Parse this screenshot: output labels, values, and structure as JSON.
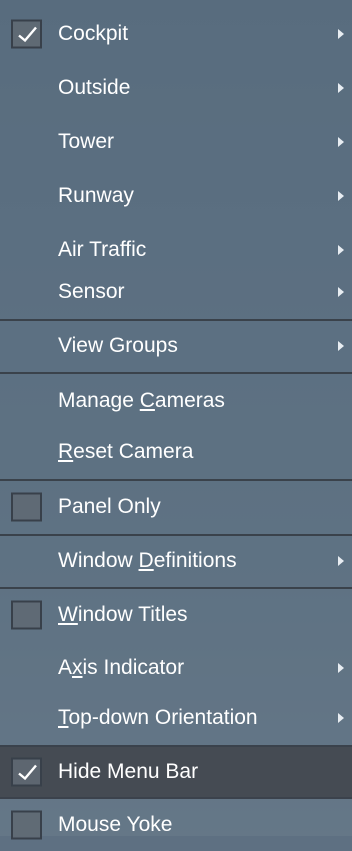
{
  "menu": {
    "items": [
      {
        "label": "Cockpit",
        "checkbox": "checked",
        "submenu": true
      },
      {
        "label": "Outside",
        "submenu": true
      },
      {
        "label": "Tower",
        "submenu": true
      },
      {
        "label": "Runway",
        "submenu": true
      },
      {
        "label": "Air Traffic",
        "submenu": true
      },
      {
        "label": "Sensor",
        "submenu": true
      },
      {
        "label": "View Groups",
        "submenu": true
      },
      {
        "label_parts": [
          "Manage ",
          "C",
          "ameras"
        ]
      },
      {
        "label_parts": [
          "",
          "R",
          "eset Camera"
        ]
      },
      {
        "label": "Panel Only",
        "checkbox": "unchecked"
      },
      {
        "label_parts": [
          "Window ",
          "D",
          "efinitions"
        ],
        "submenu": true
      },
      {
        "label_parts": [
          "",
          "W",
          "indow Titles"
        ],
        "checkbox": "unchecked"
      },
      {
        "label_parts": [
          "A",
          "x",
          "is Indicator"
        ],
        "submenu": true
      },
      {
        "label_parts": [
          "",
          "T",
          "op-down Orientation"
        ],
        "submenu": true
      },
      {
        "label": "Hide Menu Bar",
        "checkbox": "checked",
        "highlighted": true
      },
      {
        "label": "Mouse Yoke",
        "checkbox": "unchecked"
      }
    ]
  },
  "icons": {
    "check": "checkmark-icon",
    "submenu_arrow": "submenu-arrow-icon"
  },
  "colors": {
    "text": "#ffffff",
    "menu_overlay": "#566a7c",
    "highlight": "#41464c",
    "separator": "#343a42"
  }
}
